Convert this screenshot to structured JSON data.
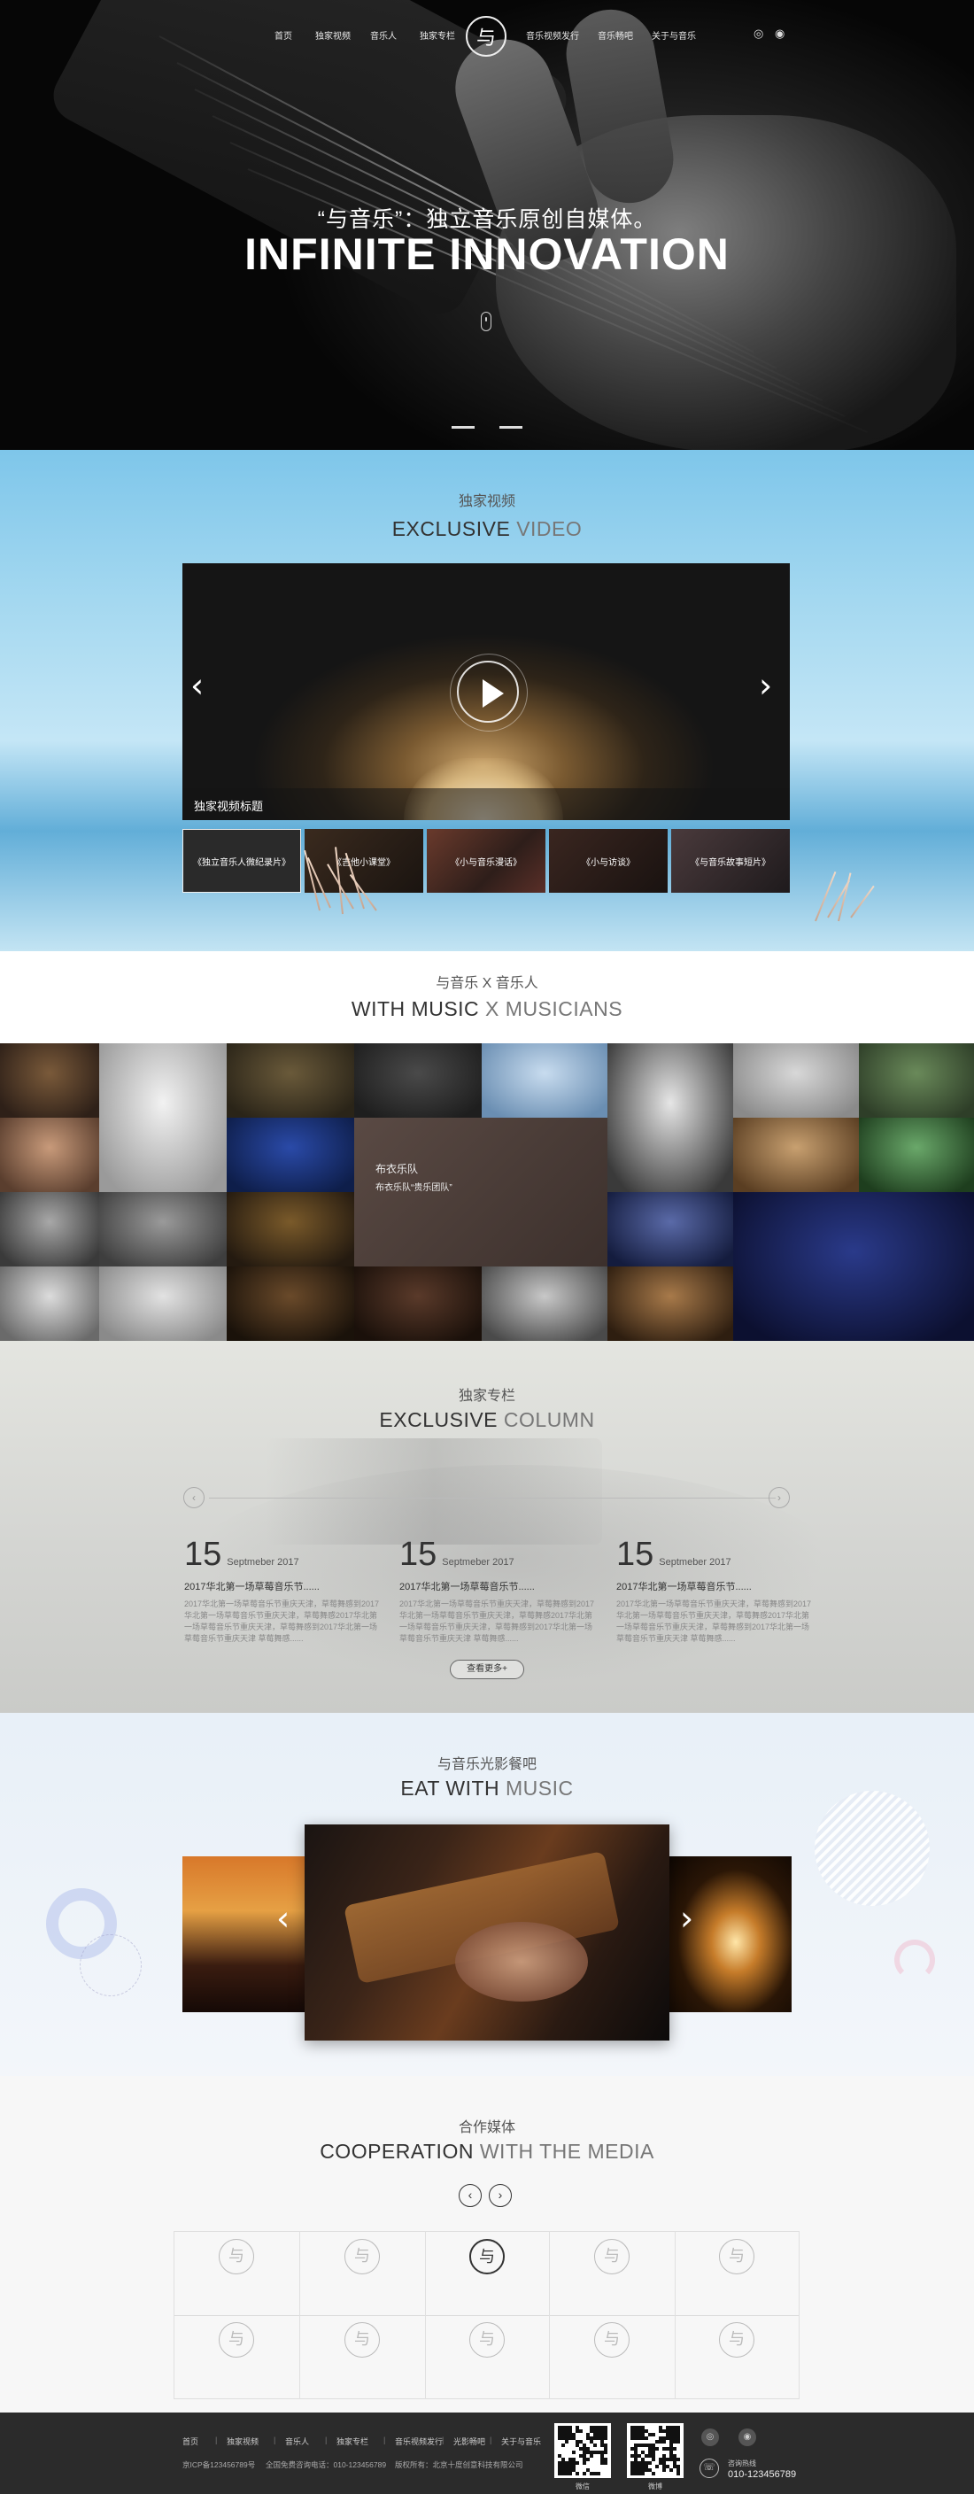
{
  "nav": {
    "left": [
      "首页",
      "独家视频",
      "音乐人",
      "独家专栏"
    ],
    "logo": "与",
    "right": [
      "音乐视频发行",
      "音乐畅吧",
      "关于与音乐"
    ],
    "social": [
      "wechat-icon",
      "weibo-icon"
    ]
  },
  "hero": {
    "subtitle": "“与音乐”：独立音乐原创自媒体。",
    "title": "INFINITE INNOVATION"
  },
  "video": {
    "heading_cn": "独家视频",
    "heading_en_dark": "EXCLUSIVE",
    "heading_en_light": " VIDEO",
    "caption": "独家视频标题",
    "thumbs": [
      "《独立音乐人微纪录片》",
      "《吉他小课堂》",
      "《小与音乐漫话》",
      "《小与访谈》",
      "《与音乐故事短片》"
    ]
  },
  "musicians": {
    "heading_cn": "与音乐  X  音乐人",
    "heading_en_dark": "WITH MUSIC",
    "heading_en_light": " X MUSICIANS",
    "feature_name": "布衣乐队",
    "feature_desc": "布衣乐队“贵乐团队”"
  },
  "column": {
    "heading_cn": "独家专栏",
    "heading_en_dark": "EXCLUSIVE",
    "heading_en_light": " COLUMN",
    "prev": "‹",
    "next": "›",
    "news": [
      {
        "day": "15",
        "month": "Septmeber  2017",
        "title": "2017华北第一场草莓音乐节......",
        "body": "2017华北第一场草莓音乐节重庆天津，草莓舞感到2017华北第一场草莓音乐节重庆天津，草莓舞感2017华北第一场草莓音乐节重庆天津，草莓舞感到2017华北第一场草莓音乐节重庆天津 草莓舞感......"
      },
      {
        "day": "15",
        "month": "Septmeber  2017",
        "title": "2017华北第一场草莓音乐节......",
        "body": "2017华北第一场草莓音乐节重庆天津，草莓舞感到2017华北第一场草莓音乐节重庆天津，草莓舞感2017华北第一场草莓音乐节重庆天津，草莓舞感到2017华北第一场草莓音乐节重庆天津 草莓舞感......"
      },
      {
        "day": "15",
        "month": "Septmeber  2017",
        "title": "2017华北第一场草莓音乐节......",
        "body": "2017华北第一场草莓音乐节重庆天津，草莓舞感到2017华北第一场草莓音乐节重庆天津，草莓舞感2017华北第一场草莓音乐节重庆天津，草莓舞感到2017华北第一场草莓音乐节重庆天津 草莓舞感......"
      }
    ],
    "more": "查看更多+"
  },
  "eat": {
    "heading_cn": "与音乐光影餐吧",
    "heading_en_dark": "EAT WITH",
    "heading_en_light": " MUSIC"
  },
  "coop": {
    "heading_cn": "合作媒体",
    "heading_en_dark": "COOPERATION",
    "heading_en_light": " WITH THE MEDIA",
    "prev": "‹",
    "next": "›",
    "logo_glyph": "与"
  },
  "footer": {
    "nav": [
      "首页",
      "独家视频",
      "音乐人",
      "独家专栏",
      "音乐视频发行",
      "光影畅吧",
      "关于与音乐"
    ],
    "icp": "京ICP备123456789号",
    "hotline": "全国免费咨询电话：010-123456789",
    "copyright": "版权所有：北京十度创意科技有限公司",
    "qr_labels": [
      "微信",
      "微博"
    ],
    "phone_label": "咨询热线",
    "phone": "010-123456789"
  }
}
